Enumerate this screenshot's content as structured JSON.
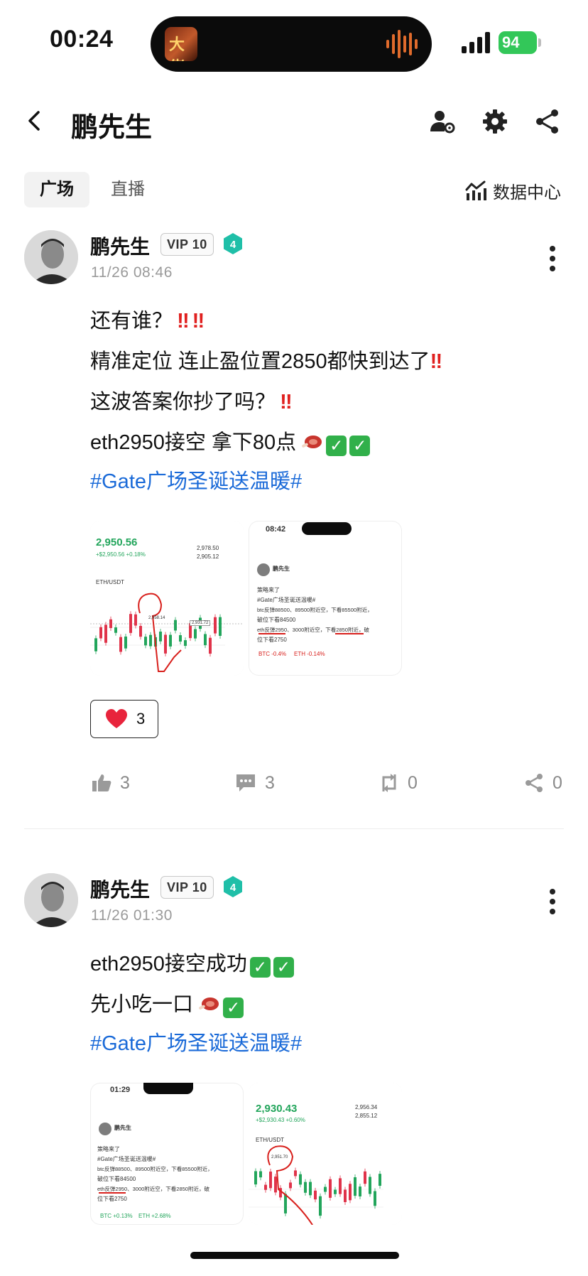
{
  "status_bar": {
    "time": "00:24",
    "island_art_text": "大佬",
    "battery": "94"
  },
  "header": {
    "title": "鹏先生"
  },
  "tabs": [
    {
      "label": "广场"
    },
    {
      "label": "直播"
    }
  ],
  "data_center": {
    "label": "数据中心"
  },
  "posts": [
    {
      "author": "鹏先生",
      "vip": "VIP 10",
      "level": "4",
      "time": "11/26 08:46",
      "lines": {
        "l1": "还有谁？",
        "l2": "精准定位 连止盈位置2850都快到达了",
        "l3": "这波答案你抄了吗？",
        "l4": "eth2950接空 拿下80点"
      },
      "hashtag": "#Gate广场圣诞送温暖#",
      "reaction_count": "3",
      "actions": {
        "like": "3",
        "comment": "3",
        "repost": "0",
        "share": "0"
      },
      "image_chart": {
        "pair": "ETH/USDT",
        "price": "2,950.56",
        "change": "+$2,950.56 +0.18%",
        "high": "2,978.50",
        "low": "2,905.12",
        "high_mark": "2,958.14",
        "mid_mark": "2,931.72"
      },
      "image_post": {
        "time": "08:42",
        "author": "鹏先生",
        "title": "策略来了",
        "tag": "#Gate广场圣诞送温暖#",
        "t1": "btc反弹88500、89500附近空，下看85500附近，",
        "t2": "破位下看84500",
        "t3": "eth反弹2950、3000附近空，下看2850附近，破",
        "t4": "位下看2750",
        "coin1": "BTC -0.4%",
        "coin2": "ETH -0.14%"
      }
    },
    {
      "author": "鹏先生",
      "vip": "VIP 10",
      "level": "4",
      "time": "11/26 01:30",
      "lines": {
        "l1": "eth2950接空成功",
        "l2": "先小吃一口"
      },
      "hashtag": "#Gate广场圣诞送温暖#",
      "image_post": {
        "time": "01:29",
        "author": "鹏先生",
        "title": "策略来了",
        "tag": "#Gate广场圣诞送温暖#",
        "t1": "btc反弹88500、89500附近空，下看85500附近，",
        "t2": "破位下看84500",
        "t3": "eth反弹2950、3000附近空，下看2850附近，破",
        "t4": "位下看2750",
        "coin1": "BTC +0.13%",
        "coin2": "ETH +2.68%"
      },
      "image_chart": {
        "pair": "ETH/USDT",
        "price": "2,930.43",
        "change": "+$2,930.43 +0.60%",
        "high": "2,956.34",
        "low": "2,855.12",
        "high_mark": "2,951.70"
      }
    }
  ],
  "colors": {
    "accent_blue": "#1a6ad8",
    "check_green": "#31b04a",
    "heart_red": "#e8243c",
    "level_teal": "#1fbfa8"
  }
}
